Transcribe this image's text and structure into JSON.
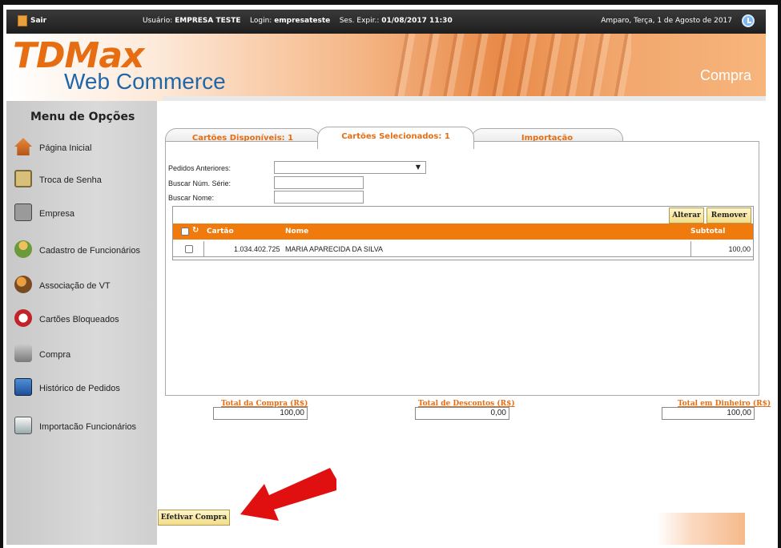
{
  "topbar": {
    "sair": "Sair",
    "usuario_label": "Usuário:",
    "usuario_value": "EMPRESA TESTE",
    "login_label": "Login:",
    "login_value": "empresateste",
    "ses_label": "Ses. Expir.:",
    "ses_value": "01/08/2017 11:30",
    "date": "Amparo, Terça, 1 de Agosto de 2017"
  },
  "banner": {
    "logo_main": "TDMax",
    "logo_sub": "Web Commerce",
    "page_name": "Compra"
  },
  "sidebar": {
    "title": "Menu de Opções",
    "items": [
      {
        "label": "Página Inicial",
        "icon": "home-icon"
      },
      {
        "label": "Troca de Senha",
        "icon": "lock-icon"
      },
      {
        "label": "Empresa",
        "icon": "building-icon"
      },
      {
        "label": "Cadastro de Funcionários",
        "icon": "person-icon"
      },
      {
        "label": "Associação de VT",
        "icon": "association-icon"
      },
      {
        "label": "Cartões Bloqueados",
        "icon": "blocked-icon"
      },
      {
        "label": "Compra",
        "icon": "cart-icon"
      },
      {
        "label": "Histórico de Pedidos",
        "icon": "history-icon"
      },
      {
        "label": "Importacão Funcionários",
        "icon": "import-icon"
      }
    ]
  },
  "tabs": [
    {
      "label": "Cartões Disponíveis: 1"
    },
    {
      "label": "Cartões Selecionados: 1"
    },
    {
      "label": "Importação"
    }
  ],
  "filters": {
    "pedidos_label": "Pedidos Anteriores:",
    "pedidos_value": "",
    "serie_label": "Buscar Núm. Série:",
    "serie_value": "",
    "nome_label": "Buscar Nome:",
    "nome_value": ""
  },
  "grid": {
    "alterar": "Alterar",
    "remover": "Remover",
    "headers": {
      "cartao": "Cartão",
      "nome": "Nome",
      "subtotal": "Subtotal"
    },
    "rows": [
      {
        "cartao": "1.034.402.725",
        "nome": "MARIA APARECIDA DA SILVA",
        "subtotal": "100,00"
      }
    ]
  },
  "totals": {
    "compra_label": "Total da Compra (R$)",
    "compra_value": "100,00",
    "descontos_label": "Total de Descontos (R$)",
    "descontos_value": "0,00",
    "dinheiro_label": "Total em Dinheiro (R$)",
    "dinheiro_value": "100,00"
  },
  "actions": {
    "efetivar": "Efetivar Compra"
  },
  "colors": {
    "accent_orange": "#f07a0c",
    "logo_orange": "#e66d12",
    "logo_blue": "#1f67a8",
    "arrow_red": "#e01010"
  }
}
